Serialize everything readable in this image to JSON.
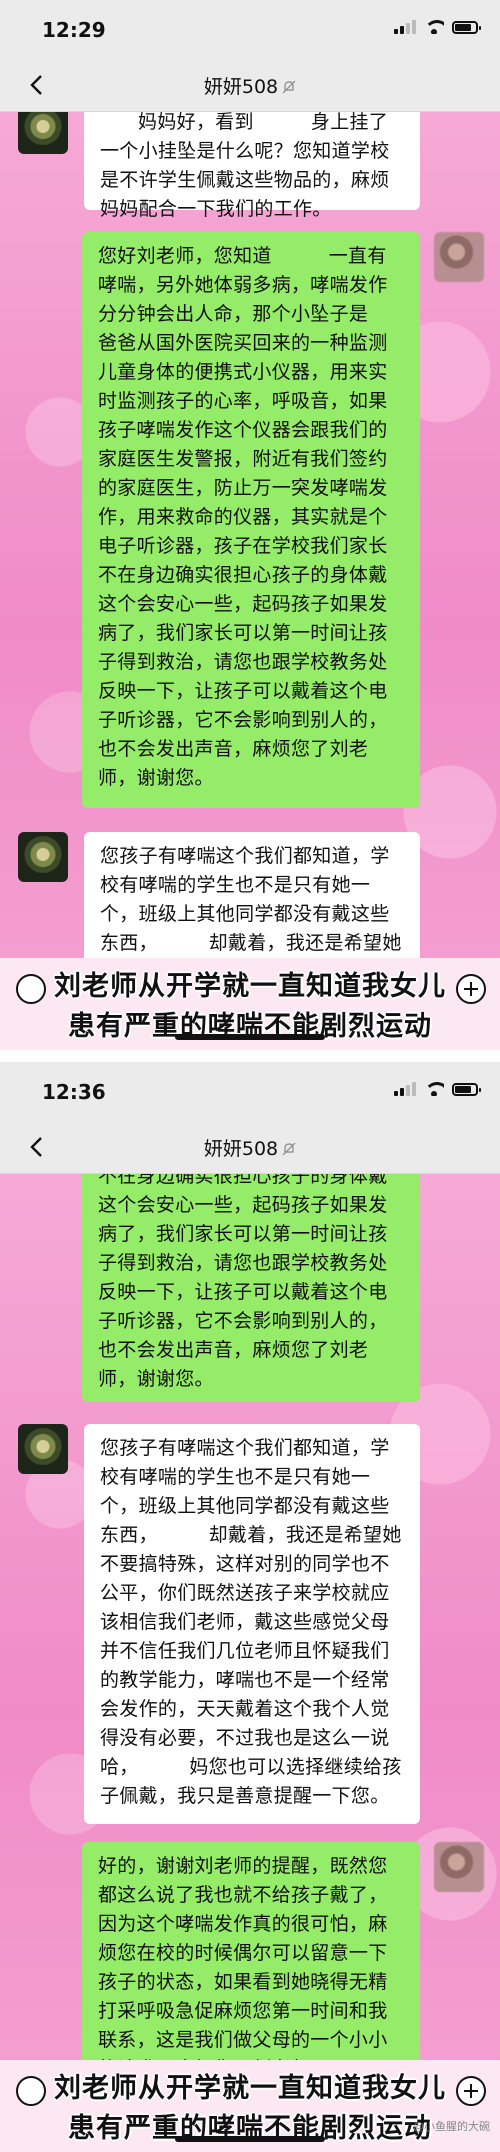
{
  "watermark": "@小鱼腥的大碗",
  "panels": [
    {
      "status_time": "12:29",
      "chat_title": "妍妍508",
      "messages": [
        {
          "side": "left",
          "text": "      妈妈好，看到         身上挂了一个小挂坠是什么呢？您知道学校是不许学生佩戴这些物品的，麻烦妈妈配合一下我们的工作。"
        },
        {
          "side": "right",
          "text": "您好刘老师，您知道         一直有哮喘，另外她体弱多病，哮喘发作分分钟会出人命，那个小坠子是         爸爸从国外医院买回来的一种监测儿童身体的便携式小仪器，用来实时监测孩子的心率，呼吸音，如果孩子哮喘发作这个仪器会跟我们的家庭医生发警报，附近有我们签约的家庭医生，防止万一突发哮喘发作，用来救命的仪器，其实就是个电子听诊器，孩子在学校我们家长不在身边确实很担心孩子的身体戴这个会安心一些，起码孩子如果发病了，我们家长可以第一时间让孩子得到救治，请您也跟学校教务处反映一下，让孩子可以戴着这个电子听诊器，它不会影响到别人的，也不会发出声音，麻烦您了刘老师，谢谢您。"
        },
        {
          "side": "left",
          "text": "您孩子有哮喘这个我们都知道，学校有哮喘的学生也不是只有她一个，班级上其他同学都没有戴这些东西，        却戴着，我还是希望她不要搞特殊，这样对别的同学也不公平，你们既然送孩子来学校就应该相信我们老师，戴这些感觉父母并不信任我们几位老师且怀疑我们"
        }
      ],
      "caption_line1": "刘老师从开学就一直知道我女儿",
      "caption_line2": "患有严重的哮喘不能剧烈运动"
    },
    {
      "status_time": "12:36",
      "chat_title": "妍妍508",
      "messages": [
        {
          "side": "right",
          "text": "不在身边确实很担心孩子的身体戴这个会安心一些，起码孩子如果发病了，我们家长可以第一时间让孩子得到救治，请您也跟学校教务处反映一下，让孩子可以戴着这个电子听诊器，它不会影响到别人的，也不会发出声音，麻烦您了刘老师，谢谢您。"
        },
        {
          "side": "left",
          "text": "您孩子有哮喘这个我们都知道，学校有哮喘的学生也不是只有她一个，班级上其他同学都没有戴这些东西，        却戴着，我还是希望她不要搞特殊，这样对别的同学也不公平，你们既然送孩子来学校就应该相信我们老师，戴这些感觉父母并不信任我们几位老师且怀疑我们的教学能力，哮喘也不是一个经常会发作的，天天戴着这个我个人觉得没有必要，不过我也是这么一说哈，        妈您也可以选择继续给孩子佩戴，我只是善意提醒一下您。"
        },
        {
          "side": "right",
          "text": "好的，谢谢刘老师的提醒，既然您都这么说了我也就不给孩子戴了，因为这个哮喘发作真的很可怕，麻烦您在校的时候偶尔可以留意一下孩子的状态，如果看到她晓得无精打采呼吸急促麻烦您第一时间和我联系，这是我们做父母的一个小小的请求，麻烦您了刘老师。"
        }
      ],
      "caption_line1": "刘老师从开学就一直知道我女儿",
      "caption_line2": "患有严重的哮喘不能剧烈运动"
    }
  ]
}
